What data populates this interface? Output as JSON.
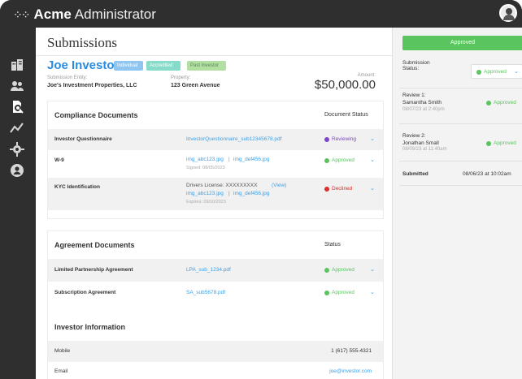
{
  "app": {
    "brand": "Acme",
    "suffix": "Administrator"
  },
  "sidebar": {
    "items": [
      {
        "icon": "building-icon"
      },
      {
        "icon": "users-icon"
      },
      {
        "icon": "document-search-icon",
        "active": true
      },
      {
        "icon": "analytics-icon"
      },
      {
        "icon": "gear-icon"
      },
      {
        "icon": "profile-icon"
      }
    ]
  },
  "page": {
    "title": "Submissions"
  },
  "investor": {
    "name": "Joe Investor",
    "tags": [
      "Individual",
      "Accredited",
      "Past Investor"
    ],
    "entity_label": "Submission Entity:",
    "entity_value": "Joe's Investment Properties, LLC",
    "property_label": "Property:",
    "property_value": "123 Green Avenue",
    "amount_label": "Amount:",
    "amount_value": "$50,000.00"
  },
  "compliance": {
    "title": "Compliance Documents",
    "status_header": "Document Status",
    "rows": [
      {
        "name": "Investor Questionnaire",
        "doc": "InvestorQuestionnaire_sub12345678.pdf",
        "status": "Reviewing",
        "status_color": "#7d45c8"
      },
      {
        "name": "W-9",
        "doc1": "img_abc123.jpg",
        "sep": "|",
        "doc2": "img_def456.jpg",
        "sub": "Signed: 08/05/2023",
        "status": "Approved",
        "status_color": "#5ac45e"
      },
      {
        "name": "KYC Identification",
        "line1_prefix": "Drivers License: XXXXXXXXX",
        "line1_link": "(View)",
        "doc1": "img_abc123.jpg",
        "sep": "|",
        "doc2": "img_def456.jpg",
        "sub": "Expires: 09/10/2023",
        "status": "Declined",
        "status_color": "#d9302f"
      }
    ]
  },
  "agreements": {
    "title": "Agreement Documents",
    "status_header": "Status",
    "rows": [
      {
        "name": "Limited Partnership Agreement",
        "doc": "LPA_sub_1234.pdf",
        "status": "Approved",
        "status_color": "#5ac45e"
      },
      {
        "name": "Subscription Agreement",
        "doc": "SA_sub5678.pdf",
        "status": "Approved",
        "status_color": "#5ac45e"
      }
    ]
  },
  "investor_info": {
    "title": "Investor Information",
    "rows": [
      {
        "label": "Mobile",
        "value": "1 (617) 555-4321"
      },
      {
        "label": "Email",
        "value": "joe@investor.com"
      }
    ]
  },
  "panel": {
    "banner": "Approved",
    "submission_status_label": "Submission\nStatus:",
    "submission_status_value": "Approved",
    "review1_title": "Review 1:",
    "review1_name": "Samantha Smith",
    "review1_time": "08/07/23 at 2:40pm",
    "review1_status": "Approved",
    "review2_title": "Review 2:",
    "review2_name": "Jonathan Small",
    "review2_time": "08/09/23 at 11:40am",
    "review2_status": "Approved",
    "submitted_label": "Submitted",
    "submitted_value": "08/06/23 at 10:02am"
  },
  "colors": {
    "accent": "#2a8be0",
    "approved": "#5ac45e",
    "reviewing": "#7d45c8",
    "declined": "#d9302f"
  }
}
